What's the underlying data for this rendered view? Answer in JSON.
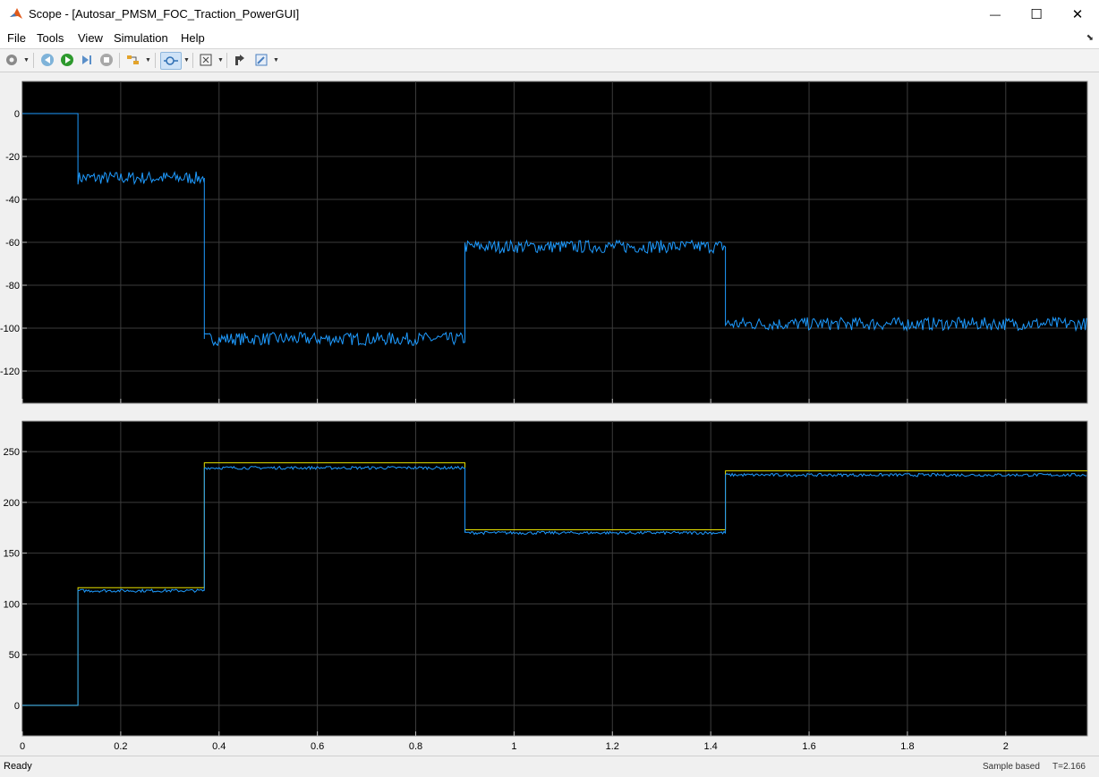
{
  "window": {
    "title": "Scope - [Autosar_PMSM_FOC_Traction_PowerGUI]",
    "minimize_glyph": "—",
    "maximize_glyph": "☐",
    "close_glyph": "✕"
  },
  "menu": {
    "items": [
      "File",
      "Tools",
      "View",
      "Simulation",
      "Help"
    ]
  },
  "toolbar": {
    "icons": [
      "settings-icon",
      "step-back-icon",
      "run-icon",
      "step-forward-icon",
      "stop-icon",
      "highlight-icon",
      "zoom-icon",
      "autoscale-icon",
      "cursor-measure-icon",
      "edit-style-icon"
    ]
  },
  "plot": {
    "background": "#000000",
    "grid_color": "#3c3c3c",
    "axes_frame_color": "#909090",
    "tick_color": "#bdbdbd",
    "series_blue": "#1e9bff",
    "series_yellow": "#e6e000",
    "x_ticks": [
      "0",
      "0.2",
      "0.4",
      "0.6",
      "0.8",
      "1",
      "1.2",
      "1.4",
      "1.6",
      "1.8",
      "2"
    ]
  },
  "chart_data": [
    {
      "type": "line",
      "xlim": [
        0,
        2.166
      ],
      "ylim": [
        -135,
        15
      ],
      "y_ticks": [
        0,
        -20,
        -40,
        -60,
        -80,
        -100,
        -120
      ],
      "grid": true,
      "series": [
        {
          "color": "#1e9bff",
          "x": [
            0,
            0.113,
            0.113,
            0.37,
            0.37,
            0.9,
            0.9,
            1.43,
            1.43,
            2.166
          ],
          "values": [
            0,
            0,
            -30,
            -30,
            -105,
            -105,
            -62,
            -62,
            -98,
            -98
          ],
          "noise_amplitude": [
            0,
            0,
            3,
            3,
            3,
            3,
            3,
            3,
            3,
            3
          ]
        }
      ]
    },
    {
      "type": "line",
      "xlim": [
        0,
        2.166
      ],
      "ylim": [
        -30,
        280
      ],
      "y_ticks": [
        0,
        50,
        100,
        150,
        200,
        250
      ],
      "grid": true,
      "series": [
        {
          "color": "#e6e000",
          "x": [
            0,
            0.113,
            0.113,
            0.37,
            0.37,
            0.9,
            0.9,
            1.43,
            1.43,
            2.166
          ],
          "values": [
            0,
            0,
            116,
            116,
            239,
            239,
            173,
            173,
            231,
            231
          ]
        },
        {
          "color": "#1e9bff",
          "x": [
            0,
            0.113,
            0.113,
            0.37,
            0.37,
            0.9,
            0.9,
            1.43,
            1.43,
            2.166
          ],
          "values": [
            0,
            0,
            113,
            113,
            234,
            234,
            170,
            170,
            227,
            227
          ],
          "noise_amplitude": [
            0,
            0,
            1.5,
            1.5,
            1.5,
            1.5,
            1.5,
            1.5,
            1.5,
            1.5
          ]
        }
      ]
    }
  ],
  "status": {
    "ready": "Ready",
    "sample_mode": "Sample based",
    "time": "T=2.166"
  }
}
